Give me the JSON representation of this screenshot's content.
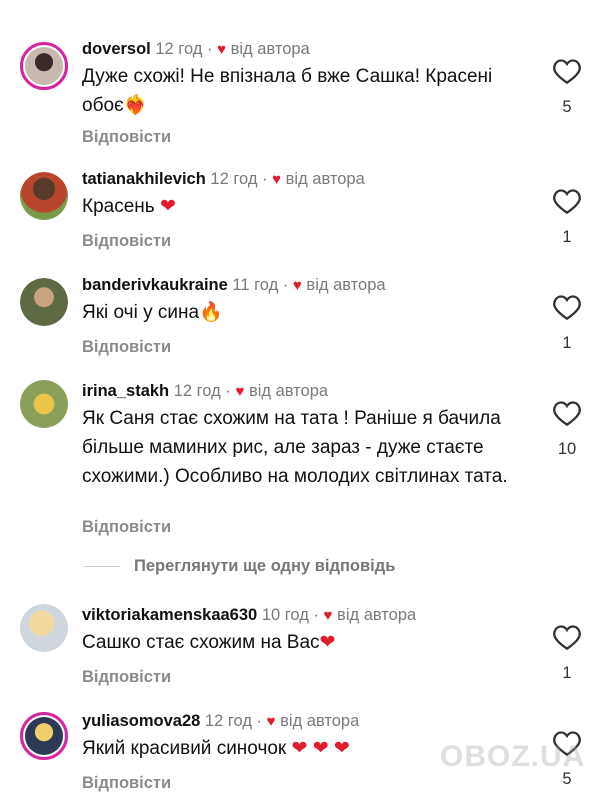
{
  "comments": [
    {
      "user": "doversol",
      "time": "12 год",
      "dot": "·",
      "by": "від автора",
      "text": "Дуже схожі! Не впізнала б вже Сашка! Красені обоє",
      "emoji": "❤‍🔥",
      "reply": "Відповісти",
      "likes": "5"
    },
    {
      "user": "tatianakhilevich",
      "time": "12 год",
      "dot": "·",
      "by": "від автора",
      "text": "Красень",
      "emoji": "❤",
      "reply": "Відповісти",
      "likes": "1"
    },
    {
      "user": "banderivkaukraine",
      "time": "11 год",
      "dot": "·",
      "by": "від автора",
      "text": "Які очі у сина",
      "emoji": "🔥",
      "reply": "Відповісти",
      "likes": "1"
    },
    {
      "user": "irina_stakh",
      "time": "12 год",
      "dot": "·",
      "by": "від автора",
      "text": "Як Саня стає схожим на тата ! Раніше я бачила більше маминих рис, але зараз - дуже стаєте схожими.) Особливо на молодих світлинах тата.",
      "emoji": "",
      "reply": "Відповісти",
      "likes": "10"
    },
    {
      "user": "viktoriakamenskaa630",
      "time": "10 год",
      "dot": "·",
      "by": "від автора",
      "text": "Сашко стає схожим на Вас",
      "emoji": "❤",
      "reply": "Відповісти",
      "likes": "1"
    },
    {
      "user": "yuliasomova28",
      "time": "12 год",
      "dot": "·",
      "by": "від автора",
      "text": "Який красивий синочок",
      "emoji": "❤ ❤ ❤",
      "reply": "Відповісти",
      "likes": "5"
    }
  ],
  "more_replies": "Переглянути ще одну відповідь",
  "watermark": "OBOZ.UA",
  "colors": {
    "heart": "#e01d2f",
    "muted": "#8b8b8b"
  }
}
